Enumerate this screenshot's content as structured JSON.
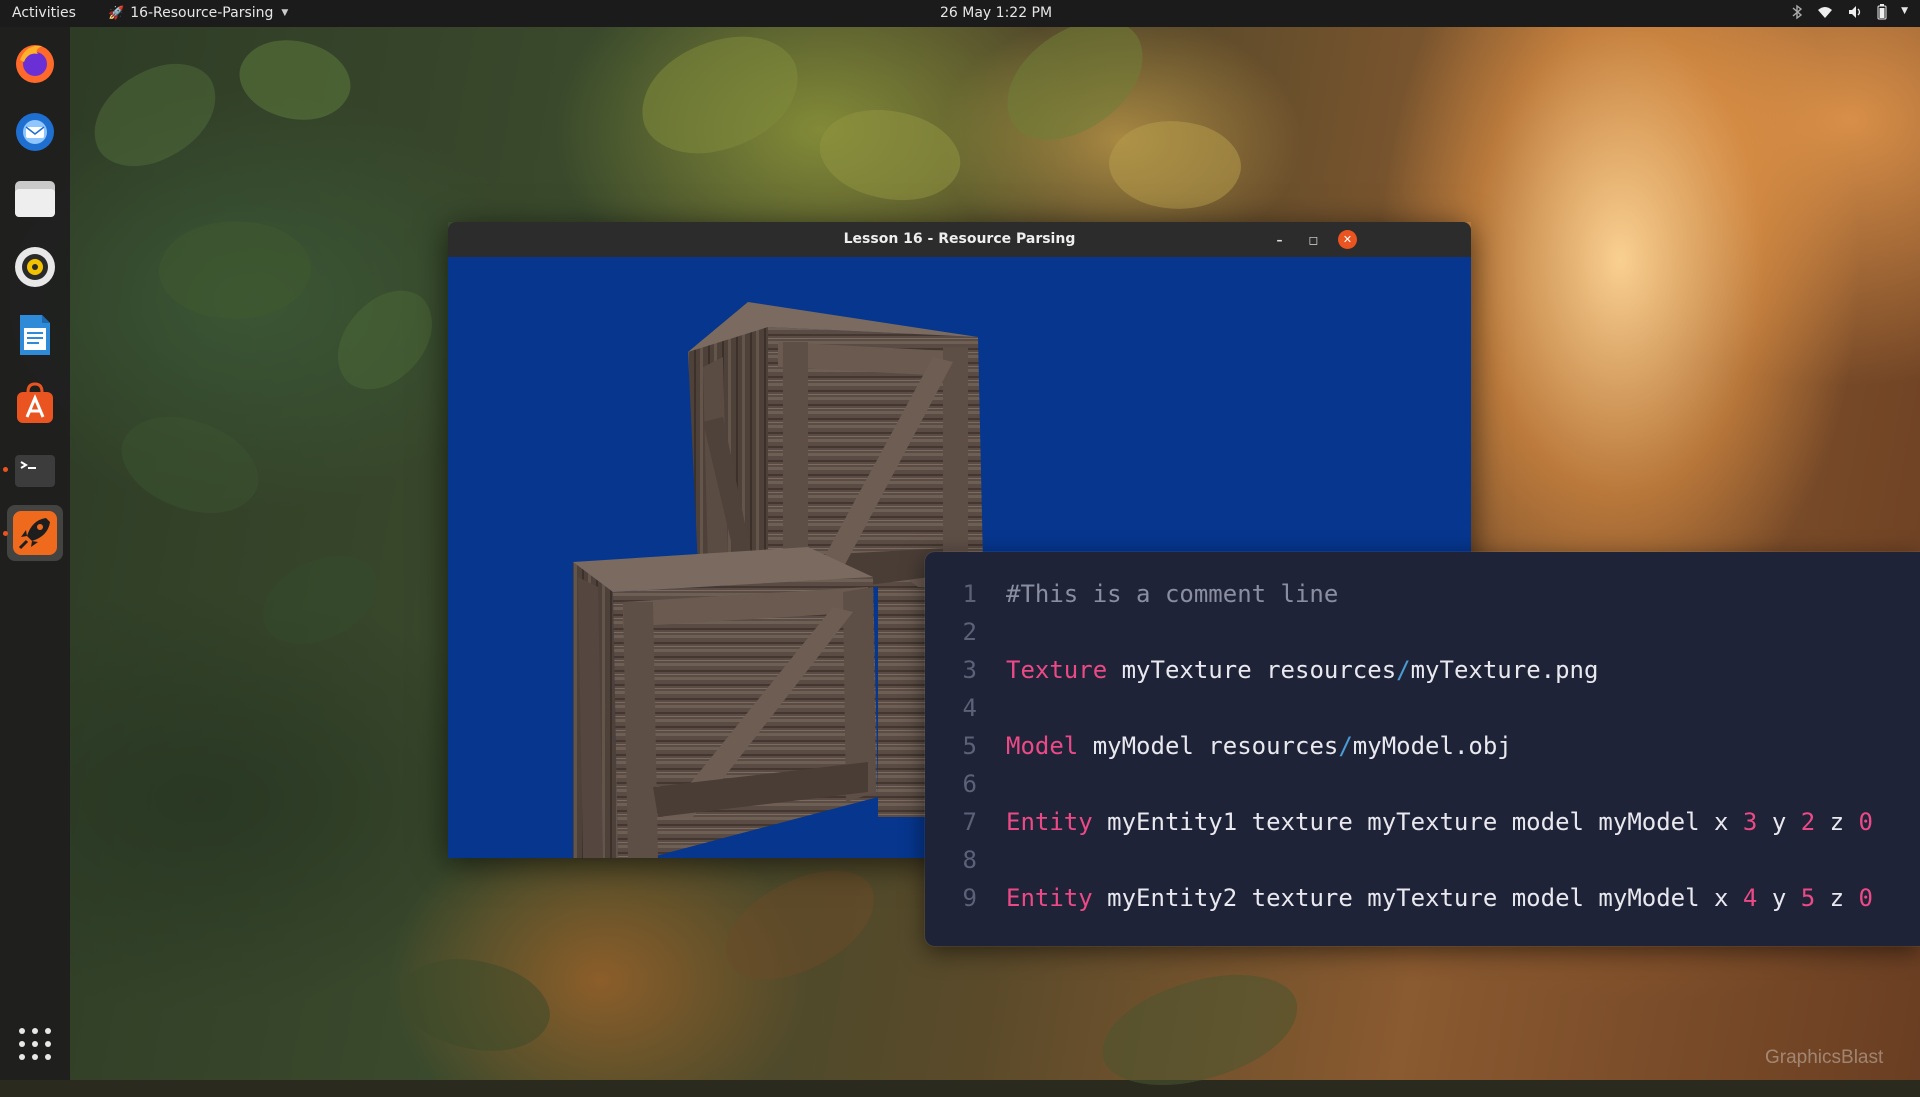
{
  "topbar": {
    "activities": "Activities",
    "app_name": "16-Resource-Parsing",
    "clock": "26 May  1:22 PM"
  },
  "dock": {
    "items": [
      "firefox",
      "thunderbird",
      "files",
      "rhythmbox",
      "libreoffice-writer",
      "ubuntu-software",
      "terminal",
      "rocket-app"
    ]
  },
  "window": {
    "title": "Lesson 16 - Resource Parsing",
    "background_color": "#06368e"
  },
  "code": {
    "lines": [
      {
        "n": "1",
        "tokens": [
          {
            "t": "#This is a comment line",
            "c": "comment"
          }
        ]
      },
      {
        "n": "2",
        "tokens": []
      },
      {
        "n": "3",
        "tokens": [
          {
            "t": "Texture",
            "c": "kw"
          },
          {
            "t": " myTexture resources",
            "c": "plain"
          },
          {
            "t": "/",
            "c": "sep"
          },
          {
            "t": "myTexture.png",
            "c": "plain"
          }
        ]
      },
      {
        "n": "4",
        "tokens": []
      },
      {
        "n": "5",
        "tokens": [
          {
            "t": "Model",
            "c": "kw"
          },
          {
            "t": " myModel resources",
            "c": "plain"
          },
          {
            "t": "/",
            "c": "sep"
          },
          {
            "t": "myModel.obj",
            "c": "plain"
          }
        ]
      },
      {
        "n": "6",
        "tokens": []
      },
      {
        "n": "7",
        "tokens": [
          {
            "t": "Entity",
            "c": "kw"
          },
          {
            "t": " myEntity1 texture myTexture model myModel x ",
            "c": "plain"
          },
          {
            "t": "3",
            "c": "num"
          },
          {
            "t": " y ",
            "c": "plain"
          },
          {
            "t": "2",
            "c": "num"
          },
          {
            "t": " z ",
            "c": "plain"
          },
          {
            "t": "0",
            "c": "num"
          }
        ]
      },
      {
        "n": "8",
        "tokens": []
      },
      {
        "n": "9",
        "tokens": [
          {
            "t": "Entity",
            "c": "kw"
          },
          {
            "t": " myEntity2 texture myTexture model myModel x ",
            "c": "plain"
          },
          {
            "t": "4",
            "c": "num"
          },
          {
            "t": " y ",
            "c": "plain"
          },
          {
            "t": "5",
            "c": "num"
          },
          {
            "t": " z ",
            "c": "plain"
          },
          {
            "t": "0",
            "c": "num"
          }
        ]
      }
    ]
  },
  "watermark": "GraphicsBlast",
  "colors": {
    "accent": "#e95420",
    "keyword": "#ec4a86",
    "separator": "#4a9bd6",
    "code_bg": "#1f2338"
  }
}
